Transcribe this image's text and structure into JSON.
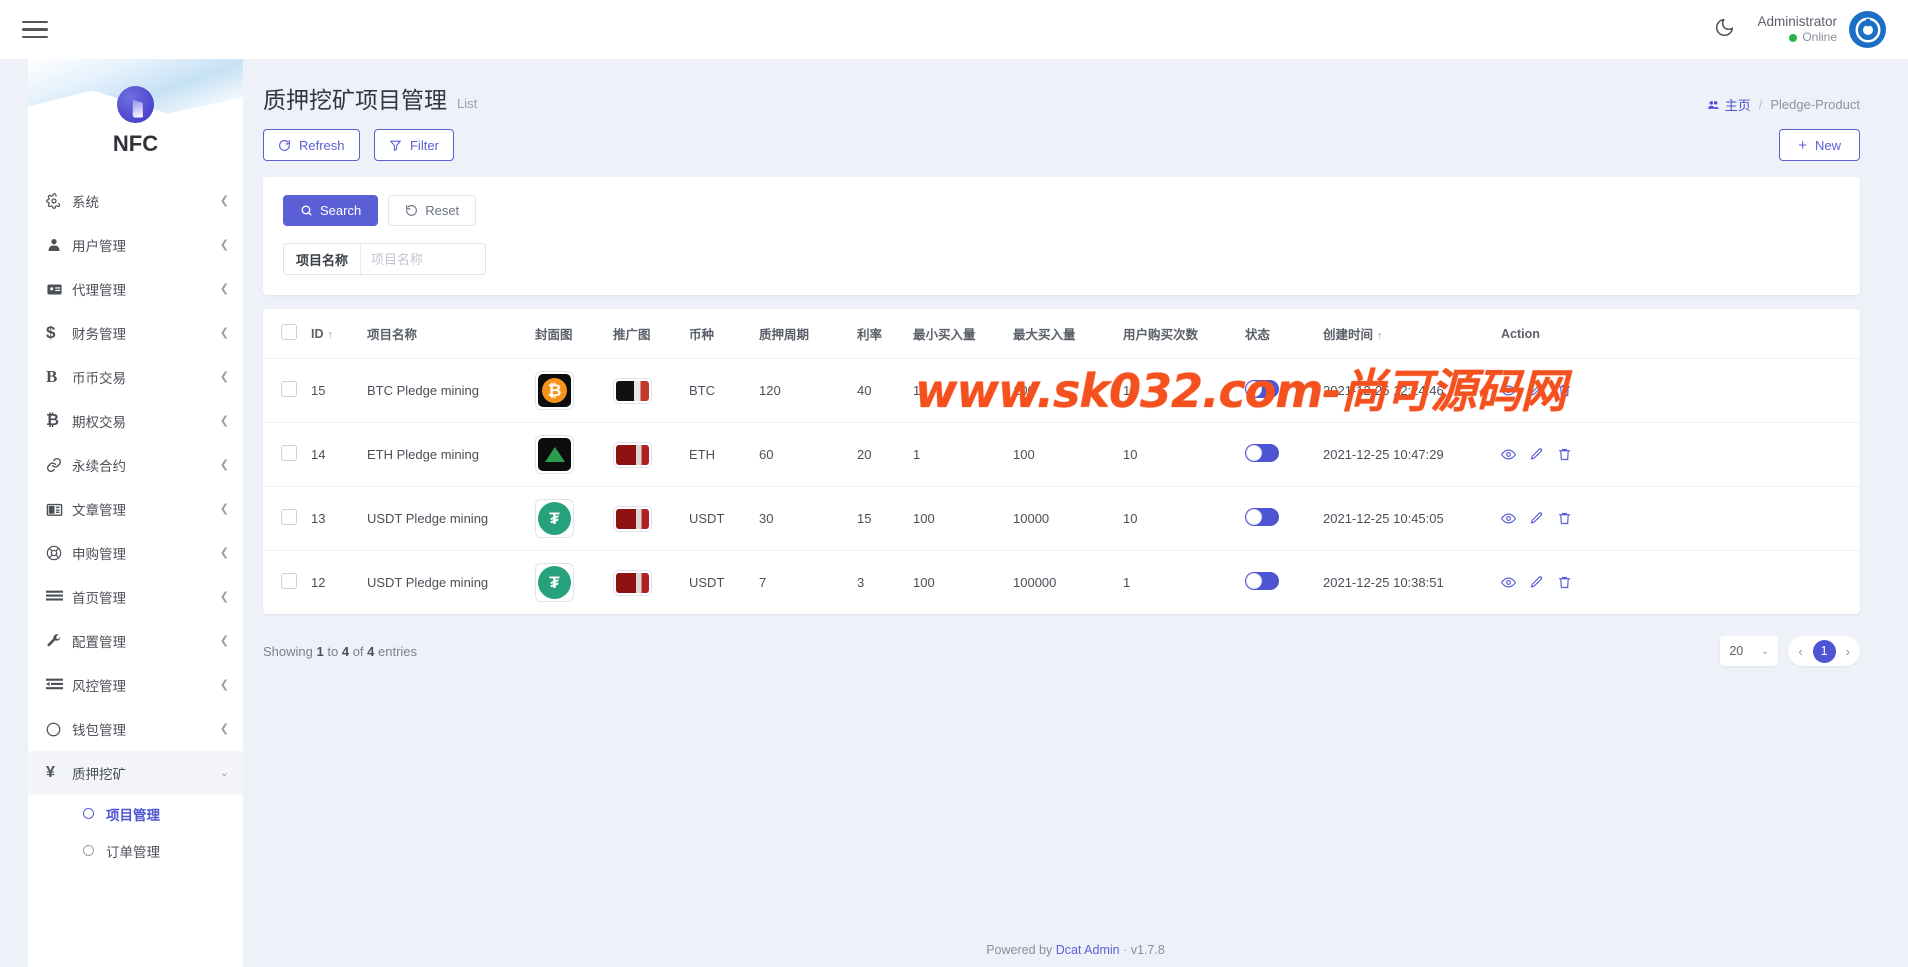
{
  "topbar": {
    "menu_toggle": "hamburger-menu",
    "theme_icon": "moon",
    "user_name": "Administrator",
    "user_status": "Online"
  },
  "sidebar": {
    "brand": "NFC",
    "items": [
      {
        "label": "系统",
        "icon": "gear"
      },
      {
        "label": "用户管理",
        "icon": "user"
      },
      {
        "label": "代理管理",
        "icon": "id-card"
      },
      {
        "label": "财务管理",
        "icon": "dollar"
      },
      {
        "label": "币币交易",
        "icon": "letter-b"
      },
      {
        "label": "期权交易",
        "icon": "bitcoin"
      },
      {
        "label": "永续合约",
        "icon": "link"
      },
      {
        "label": "文章管理",
        "icon": "newspaper"
      },
      {
        "label": "申购管理",
        "icon": "lifebuoy"
      },
      {
        "label": "首页管理",
        "icon": "bars"
      },
      {
        "label": "配置管理",
        "icon": "wrench"
      },
      {
        "label": "风控管理",
        "icon": "list-indent"
      },
      {
        "label": "钱包管理",
        "icon": "circle"
      },
      {
        "label": "质押挖矿",
        "icon": "yen"
      }
    ],
    "sub_items": [
      {
        "label": "项目管理",
        "active": true
      },
      {
        "label": "订单管理",
        "active": false
      }
    ]
  },
  "header": {
    "title": "质押挖矿项目管理",
    "subtitle": "List",
    "breadcrumb_home": "主页",
    "breadcrumb_sep": "/",
    "breadcrumb_current": "Pledge-Product"
  },
  "toolbar": {
    "refresh_label": "Refresh",
    "filter_label": "Filter",
    "new_label": "New"
  },
  "search": {
    "search_label": "Search",
    "reset_label": "Reset",
    "field_label": "项目名称",
    "field_value": "",
    "field_placeholder": "项目名称"
  },
  "table": {
    "columns": [
      "ID",
      "项目名称",
      "封面图",
      "推广图",
      "币种",
      "质押周期",
      "利率",
      "最小买入量",
      "最大买入量",
      "用户购买次数",
      "状态",
      "创建时间",
      "Action"
    ],
    "sorted_columns": [
      "ID",
      "创建时间"
    ],
    "rows": [
      {
        "id": "15",
        "name": "BTC Pledge mining",
        "cover": "btc",
        "promo": "dark",
        "coin": "BTC",
        "period": "120",
        "rate": "40",
        "min": "1",
        "max": "100",
        "times": "10",
        "status": true,
        "created": "2021-12-25 12:24:46"
      },
      {
        "id": "14",
        "name": "ETH Pledge mining",
        "cover": "eth",
        "promo": "red",
        "coin": "ETH",
        "period": "60",
        "rate": "20",
        "min": "1",
        "max": "100",
        "times": "10",
        "status": true,
        "created": "2021-12-25 10:47:29"
      },
      {
        "id": "13",
        "name": "USDT Pledge mining",
        "cover": "usdt",
        "promo": "red",
        "coin": "USDT",
        "period": "30",
        "rate": "15",
        "min": "100",
        "max": "10000",
        "times": "10",
        "status": true,
        "created": "2021-12-25 10:45:05"
      },
      {
        "id": "12",
        "name": "USDT Pledge mining",
        "cover": "usdt",
        "promo": "red",
        "coin": "USDT",
        "period": "7",
        "rate": "3",
        "min": "100",
        "max": "100000",
        "times": "1",
        "status": true,
        "created": "2021-12-25 10:38:51"
      }
    ],
    "row_actions": [
      "view-icon",
      "edit-icon",
      "delete-icon"
    ]
  },
  "footer": {
    "showing_prefix": "Showing",
    "showing_from": "1",
    "showing_to_word": "to",
    "showing_to": "4",
    "showing_of_word": "of",
    "showing_total": "4",
    "showing_suffix": "entries",
    "per_page": "20",
    "current_page": "1",
    "prev": "‹",
    "next": "›",
    "powered_prefix": "Powered by",
    "powered_name": "Dcat Admin",
    "powered_dot": "·",
    "version": "v1.7.8"
  },
  "watermark": {
    "text": "www.sk032.com-尚可源码网"
  },
  "colors": {
    "accent": "#4e54d2",
    "online": "#2bb24c",
    "watermark": "#f4511e"
  }
}
